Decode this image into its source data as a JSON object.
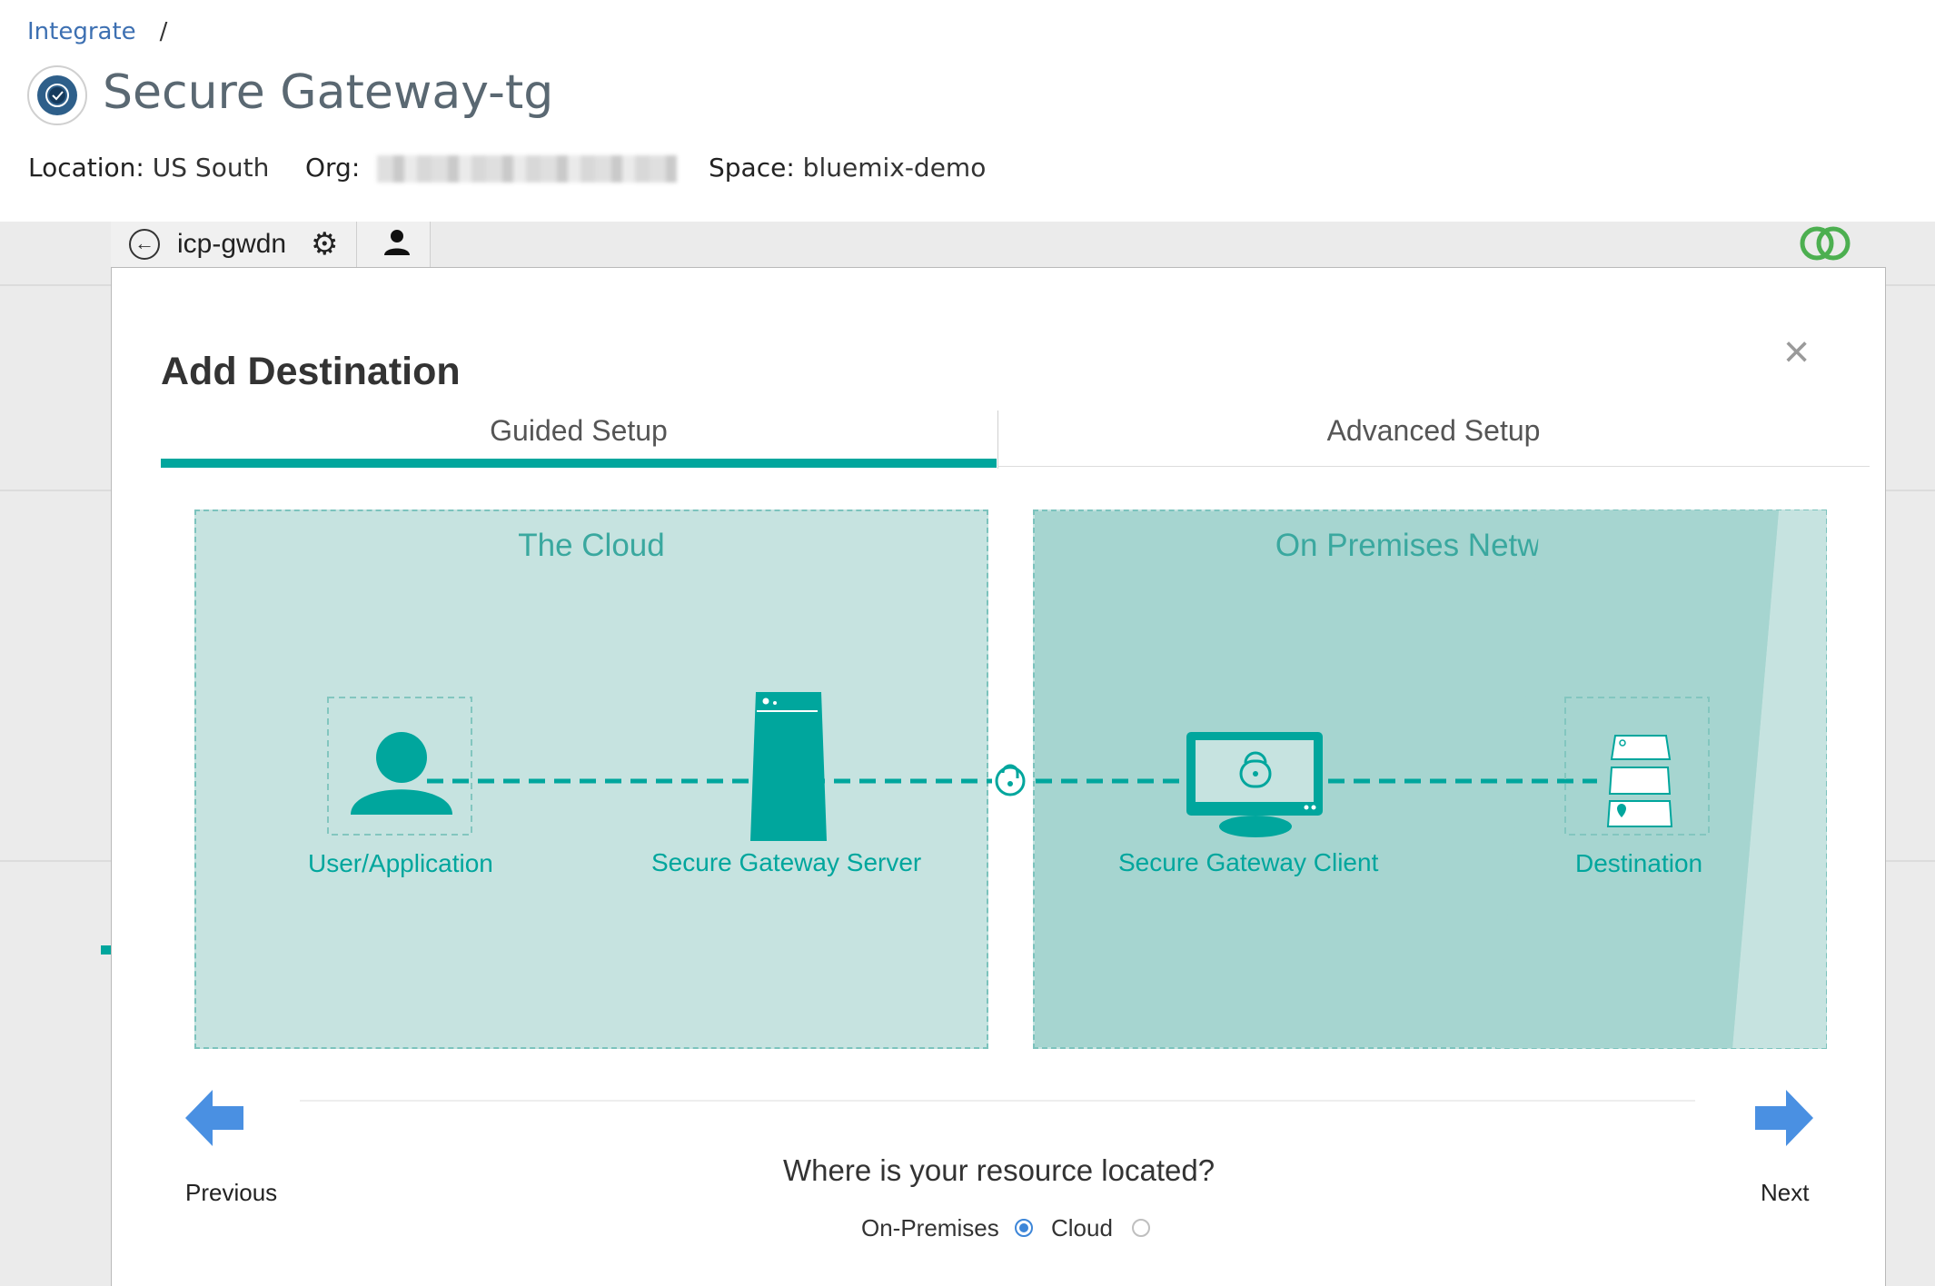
{
  "breadcrumb": {
    "parent": "Integrate",
    "separator": "/"
  },
  "header": {
    "title": "Secure Gateway-tg",
    "location_label": "Location:",
    "location_value": "US South",
    "org_label": "Org:",
    "space_label": "Space:",
    "space_value": "bluemix-demo"
  },
  "toolbar": {
    "back_icon": "arrow-left-circle-icon",
    "gateway_name": "icp-gwdn",
    "settings_icon": "gear-icon",
    "user_icon": "user-icon",
    "status_icon": "linked-rings-icon"
  },
  "modal": {
    "title": "Add Destination",
    "close_symbol": "×",
    "tabs": [
      {
        "label": "Guided Setup",
        "active": true
      },
      {
        "label": "Advanced Setup",
        "active": false
      }
    ]
  },
  "diagram": {
    "cloud_title": "The Cloud",
    "onprem_title": "On Premises Network",
    "nodes": {
      "user": "User/Application",
      "server": "Secure Gateway Server",
      "client": "Secure Gateway Client",
      "destination": "Destination"
    }
  },
  "navigation": {
    "previous_label": "Previous",
    "next_label": "Next"
  },
  "question": {
    "text": "Where is your resource located?",
    "options": [
      {
        "label": "On-Premises",
        "selected": true
      },
      {
        "label": "Cloud",
        "selected": false
      }
    ]
  },
  "colors": {
    "accent": "#00a69d",
    "panel_bg": "#c6e3e0",
    "nav_arrow": "#4a90e2",
    "radio": "#3d86d8"
  }
}
